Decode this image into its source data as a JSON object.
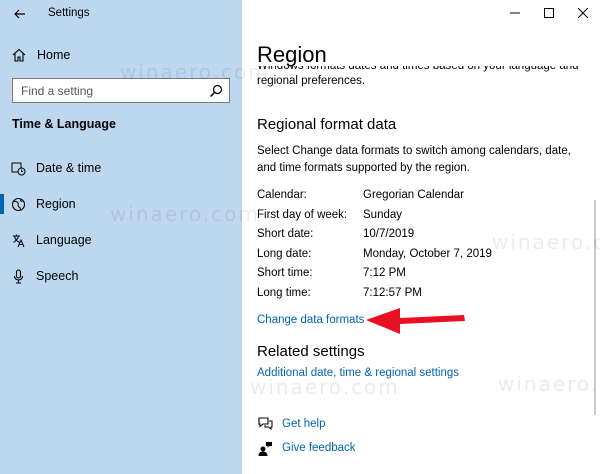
{
  "window": {
    "app_title": "Settings",
    "controls": {
      "minimize": "minimize-icon",
      "maximize": "maximize-icon",
      "close": "close-icon"
    }
  },
  "sidebar": {
    "home_label": "Home",
    "search_placeholder": "Find a setting",
    "section_title": "Time & Language",
    "items": [
      {
        "label": "Date & time",
        "icon": "calendar-clock-icon",
        "selected": false
      },
      {
        "label": "Region",
        "icon": "globe-icon",
        "selected": true
      },
      {
        "label": "Language",
        "icon": "language-icon",
        "selected": false
      },
      {
        "label": "Speech",
        "icon": "microphone-icon",
        "selected": false
      }
    ]
  },
  "main": {
    "title": "Region",
    "intro_cut": "Windows formats dates and times based on your language and",
    "intro": "regional preferences.",
    "regional_format_heading": "Regional format data",
    "regional_format_desc": "Select Change data formats to switch among calendars, date, and time formats supported by the region.",
    "formats": [
      {
        "key": "Calendar:",
        "value": "Gregorian Calendar"
      },
      {
        "key": "First day of week:",
        "value": "Sunday"
      },
      {
        "key": "Short date:",
        "value": "10/7/2019"
      },
      {
        "key": "Long date:",
        "value": "Monday, October 7, 2019"
      },
      {
        "key": "Short time:",
        "value": "7:12 PM"
      },
      {
        "key": "Long time:",
        "value": "7:12:57 PM"
      }
    ],
    "change_link": "Change data formats",
    "related_heading": "Related settings",
    "related_link": "Additional date, time & regional settings",
    "get_help": "Get help",
    "give_feedback": "Give feedback"
  },
  "watermark": "winaero.com",
  "colors": {
    "sidebar_bg": "#bdd7ee",
    "accent": "#0063b1",
    "arrow": "#e81123"
  }
}
